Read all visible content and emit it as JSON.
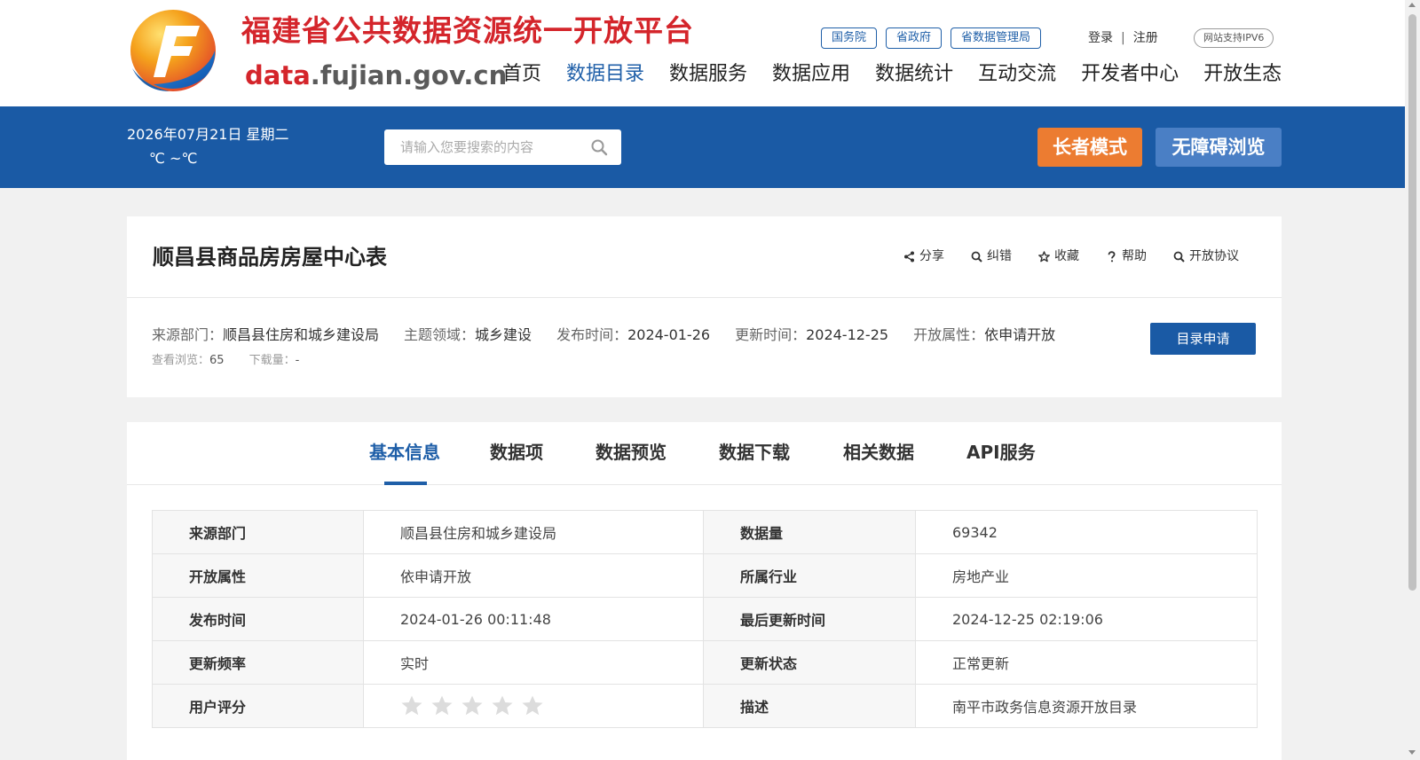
{
  "colors": {
    "brand_blue": "#1a5aa5",
    "title_red": "#d4252b",
    "elder_orange": "#ec7c31",
    "access_blue": "#4a7fc5"
  },
  "header": {
    "site_title": "福建省公共数据资源统一开放平台",
    "domain_prefix": "data",
    "domain_rest": ".fujian.gov.cn",
    "top_links": [
      "国务院",
      "省政府",
      "省数据管理局"
    ],
    "login": "登录",
    "auth_sep": "|",
    "register": "注册",
    "ipv6": "网站支持IPV6",
    "nav": [
      "首页",
      "数据目录",
      "数据服务",
      "数据应用",
      "数据统计",
      "互动交流",
      "开发者中心",
      "开放生态"
    ],
    "nav_active": "数据目录"
  },
  "bar": {
    "date": "2026年07月21日  星期二",
    "temp": "℃ ~℃",
    "search_placeholder": "请输入您要搜索的内容",
    "elder_mode": "长者模式",
    "accessible": "无障碍浏览"
  },
  "dataset": {
    "title": "顺昌县商品房房屋中心表",
    "actions": [
      "分享",
      "纠错",
      "收藏",
      "帮助",
      "开放协议"
    ],
    "meta": [
      {
        "k": "来源部门：",
        "v": "顺昌县住房和城乡建设局"
      },
      {
        "k": "主题领域：",
        "v": "城乡建设"
      },
      {
        "k": "发布时间：",
        "v": "2024-01-26"
      },
      {
        "k": "更新时间：",
        "v": "2024-12-25"
      },
      {
        "k": "开放属性：",
        "v": "依申请开放"
      }
    ],
    "views_label": "查看浏览：",
    "views": "65",
    "downloads_label": "下载量：",
    "downloads": "-",
    "apply_button": "目录申请"
  },
  "tabs": [
    "基本信息",
    "数据项",
    "数据预览",
    "数据下载",
    "相关数据",
    "API服务"
  ],
  "active_tab": "基本信息",
  "info_table": {
    "rows": [
      {
        "k1": "来源部门",
        "v1": "顺昌县住房和城乡建设局",
        "k2": "数据量",
        "v2": "69342"
      },
      {
        "k1": "开放属性",
        "v1": "依申请开放",
        "k2": "所属行业",
        "v2": "房地产业"
      },
      {
        "k1": "发布时间",
        "v1": "2024-01-26 00:11:48",
        "k2": "最后更新时间",
        "v2": "2024-12-25 02:19:06"
      },
      {
        "k1": "更新频率",
        "v1": "实时",
        "k2": "更新状态",
        "v2": "正常更新"
      },
      {
        "k1": "用户评分",
        "v1": "",
        "k2": "描述",
        "v2": "南平市政务信息资源开放目录"
      }
    ],
    "rating": {
      "value": 0,
      "max": 5
    }
  }
}
